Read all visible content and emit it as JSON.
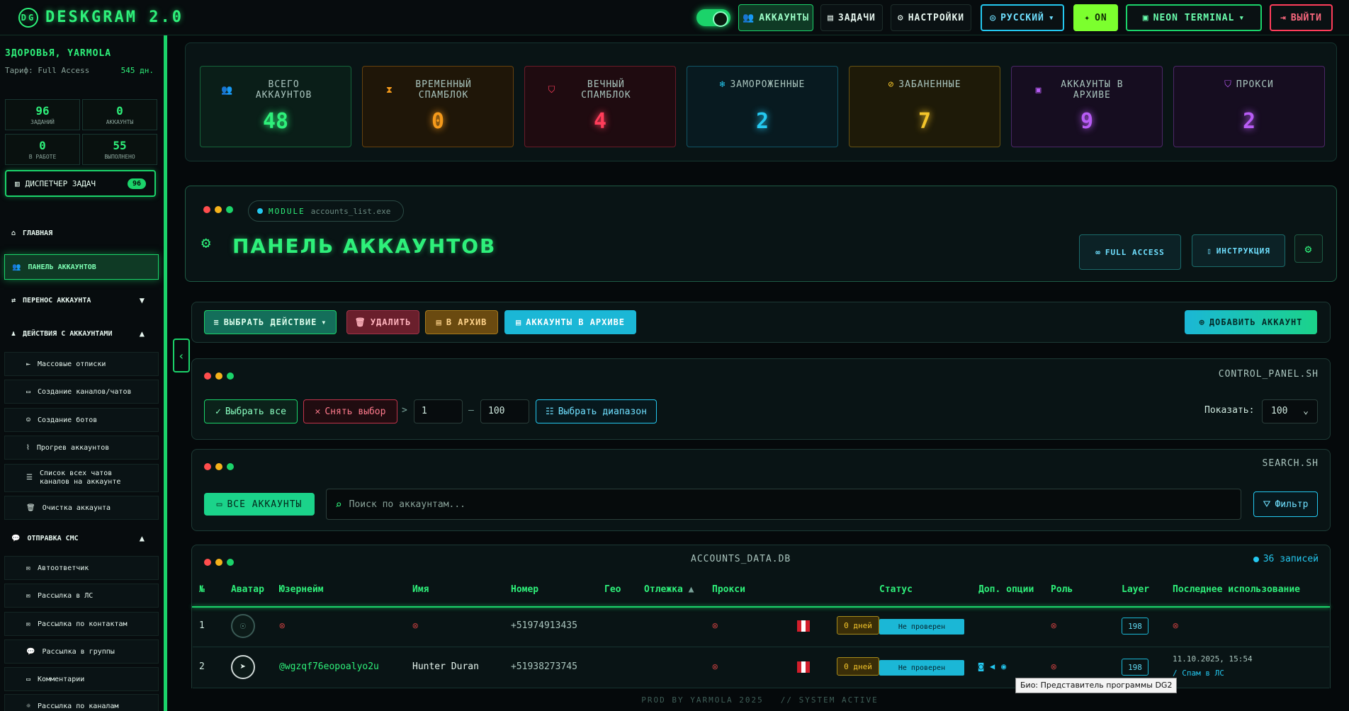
{
  "app": {
    "title": "DESKGRAM 2.0",
    "toggle_on": true
  },
  "topnav": {
    "accounts": "АККАУНТЫ",
    "tasks": "ЗАДАЧИ",
    "settings": "НАСТРОЙКИ",
    "language": "РУССКИЙ",
    "ai": "ON",
    "theme": "NEON TERMINAL",
    "logout": "ВЫЙТИ"
  },
  "sidebar": {
    "greeting": "ЗДОРОВЬЯ, YARMOLA",
    "tariff": "Тариф: Full Access",
    "days": "545 дн.",
    "stats": [
      {
        "n": "96",
        "l": "ЗАДАНИЙ"
      },
      {
        "n": "0",
        "l": "АККАУНТЫ"
      },
      {
        "n": "0",
        "l": "В РАБОТЕ"
      },
      {
        "n": "55",
        "l": "ВЫПОЛНЕНО"
      }
    ],
    "dispatcher": "ДИСПЕТЧЕР ЗАДАЧ",
    "dispatcher_count": "96",
    "nav": [
      {
        "label": "ГЛАВНАЯ"
      },
      {
        "label": "ПАНЕЛЬ АККАУНТОВ"
      },
      {
        "label": "ПЕРЕНОС АККАУНТА"
      },
      {
        "label": "ДЕЙСТВИЯ С АККАУНТАМИ"
      }
    ],
    "actions": [
      "Массовые отписки",
      "Создание каналов/чатов",
      "Создание ботов",
      "Прогрев аккаунтов",
      "Список всех чатов каналов на аккаунте",
      "Очистка аккаунта"
    ],
    "sms_section": "ОТПРАВКА СМС",
    "sms": [
      "Автоответчик",
      "Рассылка в ЛС",
      "Рассылка по контактам",
      "Рассылка в группы",
      "Комментарии",
      "Рассылка по каналам"
    ]
  },
  "stats_cards": [
    {
      "title": "ВСЕГО АККАУНТОВ",
      "value": "48",
      "color": "#2ef07a"
    },
    {
      "title": "ВРЕМЕННЫЙ СПАМБЛОК",
      "value": "0",
      "color": "#f59a1b"
    },
    {
      "title": "ВЕЧНЫЙ СПАМБЛОК",
      "value": "4",
      "color": "#ff3d5a"
    },
    {
      "title": "ЗАМОРОЖЕННЫЕ",
      "value": "2",
      "color": "#24c8f0"
    },
    {
      "title": "ЗАБАНЕННЫЕ",
      "value": "7",
      "color": "#f3c42a"
    },
    {
      "title": "АККАУНТЫ В АРХИВЕ",
      "value": "9",
      "color": "#b85cf5"
    },
    {
      "title": "ПРОКСИ",
      "value": "2",
      "color": "#b85cf5"
    }
  ],
  "module": {
    "tag": "MODULE",
    "file": "accounts_list.exe",
    "title": "ПАНЕЛЬ АККАУНТОВ",
    "access": "FULL ACCESS",
    "help": "ИНСТРУКЦИЯ"
  },
  "actions": {
    "select": "ВЫБРАТЬ ДЕЙСТВИЕ",
    "delete": "УДАЛИТЬ",
    "archive": "В АРХИВ",
    "archived": "АККАУНТЫ В АРХИВЕ",
    "add": "ДОБАВИТЬ АККАУНТ"
  },
  "control": {
    "title": "CONTROL_PANEL.SH",
    "select_all": "Выбрать все",
    "deselect": "Снять выбор",
    "from": "1",
    "to": "100",
    "range": "Выбрать диапазон",
    "show_label": "Показать:",
    "show_value": "100"
  },
  "search": {
    "title": "SEARCH.SH",
    "all": "ВСЕ АККАУНТЫ",
    "placeholder": "Поиск по аккаунтам...",
    "filter": "Фильтр"
  },
  "table": {
    "title": "ACCOUNTS_DATA.DB",
    "records": "36 записей",
    "headers": [
      "№",
      "Аватар",
      "Юзернейм",
      "Имя",
      "Номер",
      "Гео",
      "Отлежка",
      "Прокси",
      "Статус",
      "Доп. опции",
      "Роль",
      "Layer",
      "Последнее использование"
    ],
    "rows": [
      {
        "n": "1",
        "username": "",
        "name": "",
        "phone": "+51974913435",
        "days": "0 дней",
        "status": "Не проверен",
        "layer": "198",
        "last": ""
      },
      {
        "n": "2",
        "username": "@wgzqf76eopoalyo2u",
        "name": "Hunter Duran",
        "phone": "+51938273745",
        "days": "0 дней",
        "status": "Не проверен",
        "layer": "198",
        "last": "11.10.2025, 15:54",
        "last_note": "/ Спам в ЛС"
      }
    ]
  },
  "tooltip": "Био: Представитель программы DG2",
  "footer": "PROD BY YARMOLA 2025",
  "footer2": "// SYSTEM ACTIVE"
}
